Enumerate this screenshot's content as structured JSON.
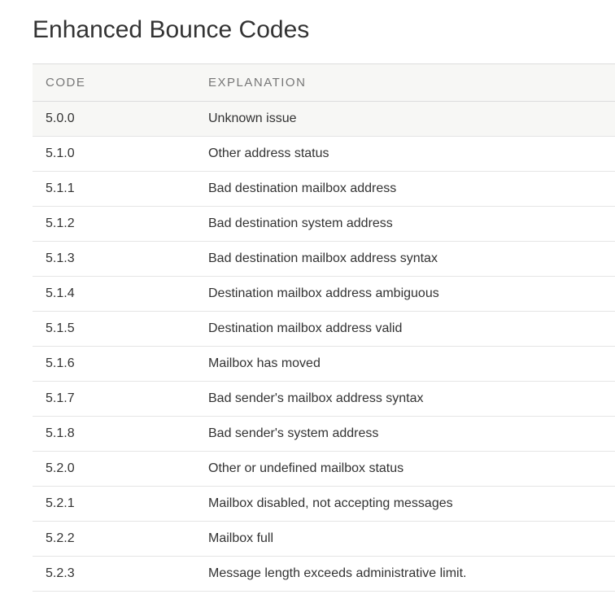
{
  "title": "Enhanced Bounce Codes",
  "table": {
    "headers": {
      "code": "CODE",
      "explanation": "EXPLANATION"
    },
    "rows": [
      {
        "code": "5.0.0",
        "explanation": "Unknown issue",
        "highlight": true
      },
      {
        "code": "5.1.0",
        "explanation": "Other address status"
      },
      {
        "code": "5.1.1",
        "explanation": "Bad destination mailbox address"
      },
      {
        "code": "5.1.2",
        "explanation": "Bad destination system address"
      },
      {
        "code": "5.1.3",
        "explanation": "Bad destination mailbox address syntax"
      },
      {
        "code": "5.1.4",
        "explanation": "Destination mailbox address ambiguous"
      },
      {
        "code": "5.1.5",
        "explanation": "Destination mailbox address valid"
      },
      {
        "code": "5.1.6",
        "explanation": "Mailbox has moved"
      },
      {
        "code": "5.1.7",
        "explanation": "Bad sender's mailbox address syntax"
      },
      {
        "code": "5.1.8",
        "explanation": "Bad sender's system address"
      },
      {
        "code": "5.2.0",
        "explanation": "Other or undefined mailbox status"
      },
      {
        "code": "5.2.1",
        "explanation": "Mailbox disabled, not accepting messages"
      },
      {
        "code": "5.2.2",
        "explanation": "Mailbox full"
      },
      {
        "code": "5.2.3",
        "explanation": "Message length exceeds administrative limit."
      }
    ]
  }
}
